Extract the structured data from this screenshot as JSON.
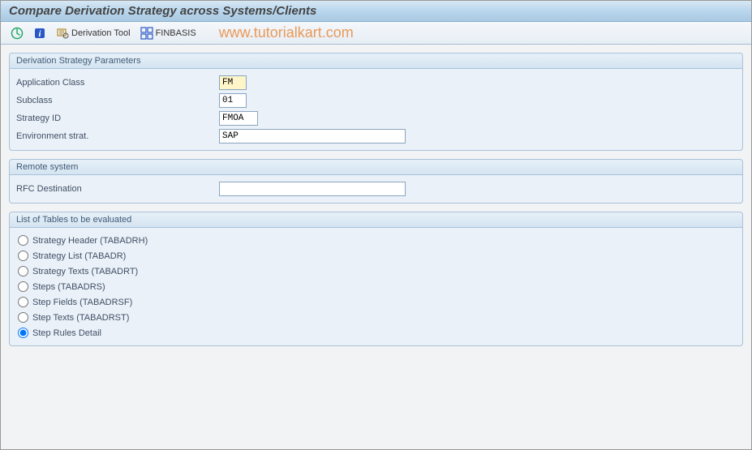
{
  "title": "Compare Derivation Strategy across Systems/Clients",
  "toolbar": {
    "execute_title": "Execute",
    "info_title": "Information",
    "derivation_tool_label": "Derivation Tool",
    "finbasis_label": "FINBASIS"
  },
  "watermark": "www.tutorialkart.com",
  "groups": {
    "params": {
      "title": "Derivation Strategy Parameters",
      "app_class": {
        "label": "Application Class",
        "value": "FM"
      },
      "subclass": {
        "label": "Subclass",
        "value": "01"
      },
      "strategy_id": {
        "label": "Strategy ID",
        "value": "FMOA"
      },
      "env_strat": {
        "label": "Environment strat.",
        "value": "SAP"
      }
    },
    "remote": {
      "title": "Remote system",
      "rfc_dest": {
        "label": "RFC Destination",
        "value": ""
      }
    },
    "tables": {
      "title": "List of Tables to be evaluated",
      "options": [
        {
          "label": "Strategy Header (TABADRH)",
          "checked": false
        },
        {
          "label": "Strategy List (TABADR)",
          "checked": false
        },
        {
          "label": "Strategy Texts (TABADRT)",
          "checked": false
        },
        {
          "label": "Steps (TABADRS)",
          "checked": false
        },
        {
          "label": "Step Fields (TABADRSF)",
          "checked": false
        },
        {
          "label": "Step Texts (TABADRST)",
          "checked": false
        },
        {
          "label": "Step Rules Detail",
          "checked": true
        }
      ]
    }
  }
}
